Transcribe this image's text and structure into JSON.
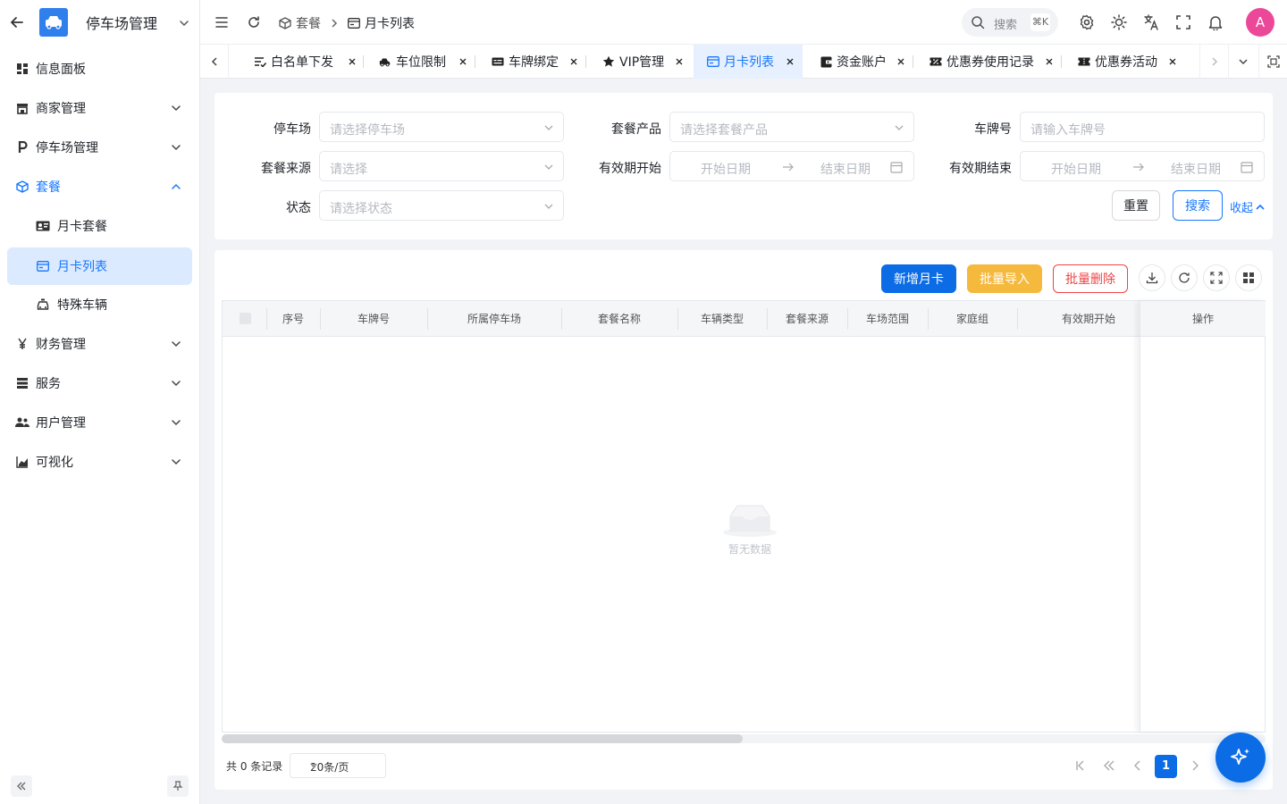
{
  "app": {
    "title": "停车场管理"
  },
  "sidebar": {
    "items": [
      {
        "label": "信息面板",
        "icon": "dashboard-icon"
      },
      {
        "label": "商家管理",
        "icon": "store-icon"
      },
      {
        "label": "停车场管理",
        "icon": "parking-icon"
      },
      {
        "label": "套餐",
        "icon": "package-icon",
        "expanded": true
      },
      {
        "label": "月卡套餐",
        "icon": "id-card-icon"
      },
      {
        "label": "月卡列表",
        "icon": "card-list-icon",
        "selected": true
      },
      {
        "label": "特殊车辆",
        "icon": "special-vehicle-icon"
      },
      {
        "label": "财务管理",
        "icon": "yen-icon"
      },
      {
        "label": "服务",
        "icon": "server-icon"
      },
      {
        "label": "用户管理",
        "icon": "users-icon"
      },
      {
        "label": "可视化",
        "icon": "chart-icon"
      }
    ]
  },
  "header": {
    "breadcrumb": [
      "套餐",
      "月卡列表"
    ],
    "search_label": "搜索",
    "search_shortcut": "⌘K",
    "avatar_letter": "A"
  },
  "tabs": [
    {
      "label": "白名单下发",
      "icon": "list-check-icon"
    },
    {
      "label": "车位限制",
      "icon": "car-icon"
    },
    {
      "label": "车牌绑定",
      "icon": "plate-icon"
    },
    {
      "label": "VIP管理",
      "icon": "star-icon"
    },
    {
      "label": "月卡列表",
      "icon": "card-list-icon",
      "active": true
    },
    {
      "label": "资金账户",
      "icon": "wallet-icon"
    },
    {
      "label": "优惠券使用记录",
      "icon": "coupon-icon"
    },
    {
      "label": "优惠券活动",
      "icon": "ticket-icon"
    }
  ],
  "filters": {
    "parking_lot": {
      "label": "停车场",
      "placeholder": "请选择停车场"
    },
    "package_product": {
      "label": "套餐产品",
      "placeholder": "请选择套餐产品"
    },
    "plate_number": {
      "label": "车牌号",
      "placeholder": "请输入车牌号"
    },
    "package_source": {
      "label": "套餐来源",
      "placeholder": "请选择"
    },
    "valid_start": {
      "label": "有效期开始",
      "start_placeholder": "开始日期",
      "end_placeholder": "结束日期"
    },
    "valid_end": {
      "label": "有效期结束",
      "start_placeholder": "开始日期",
      "end_placeholder": "结束日期"
    },
    "status": {
      "label": "状态",
      "placeholder": "请选择状态"
    },
    "reset_label": "重置",
    "search_label": "搜索",
    "collapse_label": "收起"
  },
  "toolbar": {
    "add_label": "新增月卡",
    "import_label": "批量导入",
    "delete_label": "批量删除"
  },
  "table": {
    "columns": [
      "序号",
      "车牌号",
      "所属停车场",
      "套餐名称",
      "车辆类型",
      "套餐来源",
      "车场范围",
      "家庭组",
      "有效期开始"
    ],
    "action_column": "操作",
    "empty_text": "暂无数据"
  },
  "pager": {
    "total_text": "共 0 条记录",
    "page_size": "20条/页",
    "current_page": "1"
  },
  "colors": {
    "primary": "#0b6ce5",
    "warning": "#f5b93d",
    "danger": "#ef4444",
    "avatar": "#ec4899",
    "selected_bg": "#dbeafe"
  }
}
